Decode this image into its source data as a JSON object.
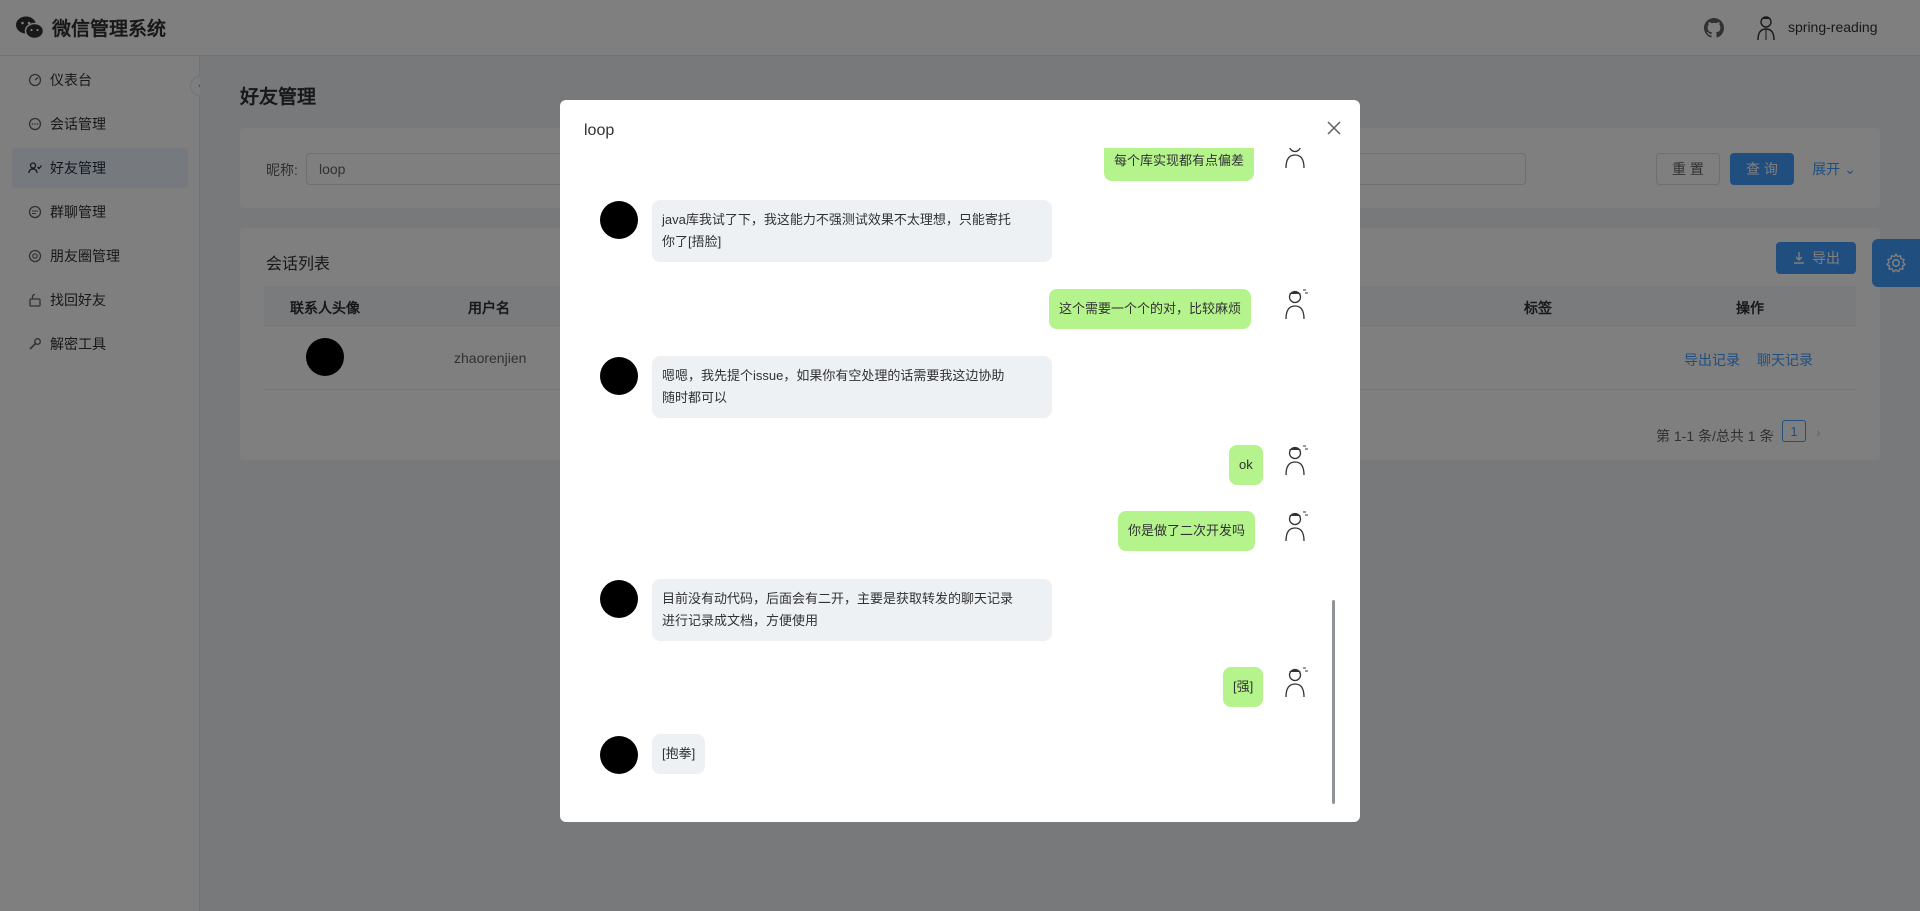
{
  "app": {
    "title": "微信管理系统"
  },
  "header": {
    "username": "spring-reading"
  },
  "sidebar": {
    "items": [
      {
        "label": "仪表台",
        "icon": "dashboard-icon"
      },
      {
        "label": "会话管理",
        "icon": "chat-icon"
      },
      {
        "label": "好友管理",
        "icon": "friends-icon",
        "active": true
      },
      {
        "label": "群聊管理",
        "icon": "group-chat-icon"
      },
      {
        "label": "朋友圈管理",
        "icon": "moments-icon"
      },
      {
        "label": "找回好友",
        "icon": "recover-icon"
      },
      {
        "label": "解密工具",
        "icon": "wrench-icon"
      }
    ]
  },
  "page": {
    "title": "好友管理"
  },
  "search": {
    "label": "昵称:",
    "value": "loop",
    "reset": "重 置",
    "query": "查 询",
    "expand": "展开"
  },
  "table": {
    "title": "会话列表",
    "export": "导出",
    "columns": [
      "联系人头像",
      "用户名",
      "标签",
      "操作"
    ],
    "rows": [
      {
        "username": "zhaorenjien",
        "actions": [
          "导出记录",
          "聊天记录"
        ]
      }
    ],
    "pagination": {
      "summary": "第 1-1 条/总共 1 条",
      "current": "1"
    }
  },
  "colors": {
    "primary": "#409eff",
    "bubble_self": "#b5f38c",
    "bubble_other": "#eef1f3"
  },
  "dialog": {
    "title": "loop",
    "messages": [
      {
        "side": "right",
        "text": "每个库实现都有点偏差"
      },
      {
        "side": "left",
        "lines": [
          "java库我试了下，我这能力不强测试效果不太理想，只能寄托",
          "你了[捂脸]"
        ]
      },
      {
        "side": "right",
        "text": "这个需要一个个的对，比较麻烦"
      },
      {
        "side": "left",
        "lines": [
          "嗯嗯，我先提个issue，如果你有空处理的话需要我这边协助",
          "随时都可以"
        ]
      },
      {
        "side": "right",
        "text": "ok"
      },
      {
        "side": "right",
        "text": "你是做了二次开发吗"
      },
      {
        "side": "left",
        "lines": [
          "目前没有动代码，后面会有二开，主要是获取转发的聊天记录",
          "进行记录成文档，方便使用"
        ]
      },
      {
        "side": "right",
        "text": "[强]"
      },
      {
        "side": "left",
        "lines": [
          "[抱拳]"
        ]
      }
    ]
  }
}
